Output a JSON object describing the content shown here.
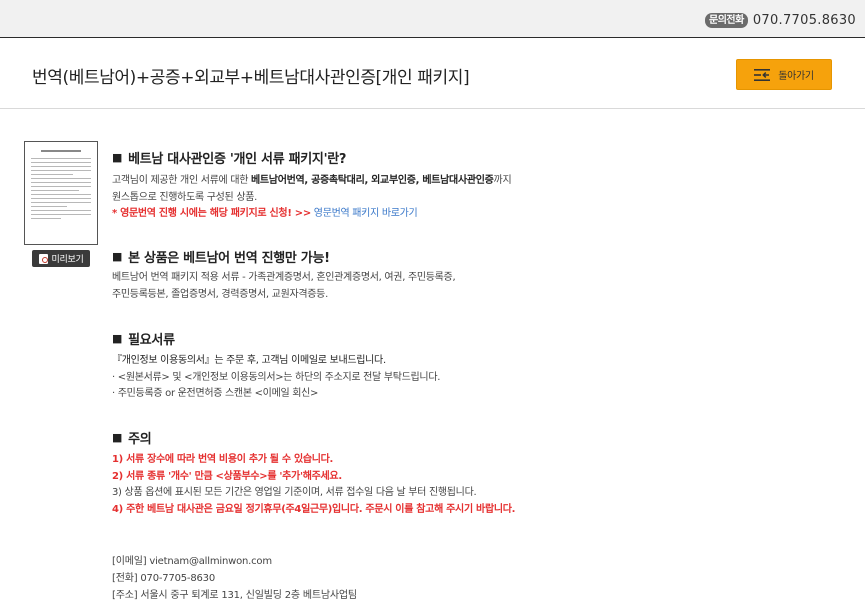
{
  "topbar": {
    "phone_badge": "문의전화",
    "phone_number": "070.7705.8630"
  },
  "header": {
    "title": "번역(베트남어)+공증+외교부+베트남대사관인증[개인 패키지]",
    "back_button": "돌아가기"
  },
  "preview": {
    "label": "미리보기"
  },
  "sections": {
    "s1": {
      "bullet": "■",
      "title": "베트남 대사관인증 '개인 서류 패키지'란?",
      "line1_prefix": "고객님이 제공한 개인 서류에 대한 ",
      "line1_bold": "베트남어번역, 공증촉탁대리, 외교부인증, 베트남대사관인증",
      "line1_suffix": "까지",
      "line2": "원스톱으로 진행하도록 구성된 상품.",
      "line3_red": "* 영문번역 진행 시에는 해당 패키지로 신청! >>",
      "line3_link": " 영문번역 패키지 바로가기"
    },
    "s2": {
      "bullet": "■",
      "title": "본 상품은 베트남어 번역 진행만 가능!",
      "line1": "베트남어 번역 패키지 적용 서류 - 가족관계증명서, 혼인관계증명서, 여권, 주민등록증,",
      "line2": "주민등록등본, 졸업증명서, 경력증명서, 교원자격증등."
    },
    "s3": {
      "bullet": "■",
      "title": "필요서류",
      "line1": "『개인정보 이용동의서』는 주문 후, 고객님 이메일로 보내드립니다.",
      "line2": "· <원본서류> 및 <개인정보 이용동의서>는 하단의 주소지로 전달 부탁드립니다.",
      "line3": "· 주민등록증 or 운전면허증 스캔본 <이메일 회신>"
    },
    "s4": {
      "bullet": "■",
      "title": "주의",
      "line1": "1) 서류 장수에 따라 번역 비용이 추가 될 수 있습니다.",
      "line2": "2) 서류 종류 '개수' 만큼 <상품부수>를 '추가'해주세요.",
      "line3": "3) 상품 옵션에 표시된 모든 기간은 영업일 기준이며, 서류 접수일 다음 날 부터 진행됩니다.",
      "line4": "4) 주한 베트남 대사관은 금요일 정기휴무(주4일근무)입니다. 주문시 이를 참고해 주시기 바랍니다."
    }
  },
  "contact": {
    "email": "[이메일] vietnam@allminwon.com",
    "phone": "[전화] 070-7705-8630",
    "address": "[주소] 서울시 중구 퇴계로 131, 신일빌딩 2층 베트남사업팀"
  },
  "colors": {
    "accent": "#f6a20c",
    "warning": "#e53030",
    "link": "#3a78c9"
  }
}
